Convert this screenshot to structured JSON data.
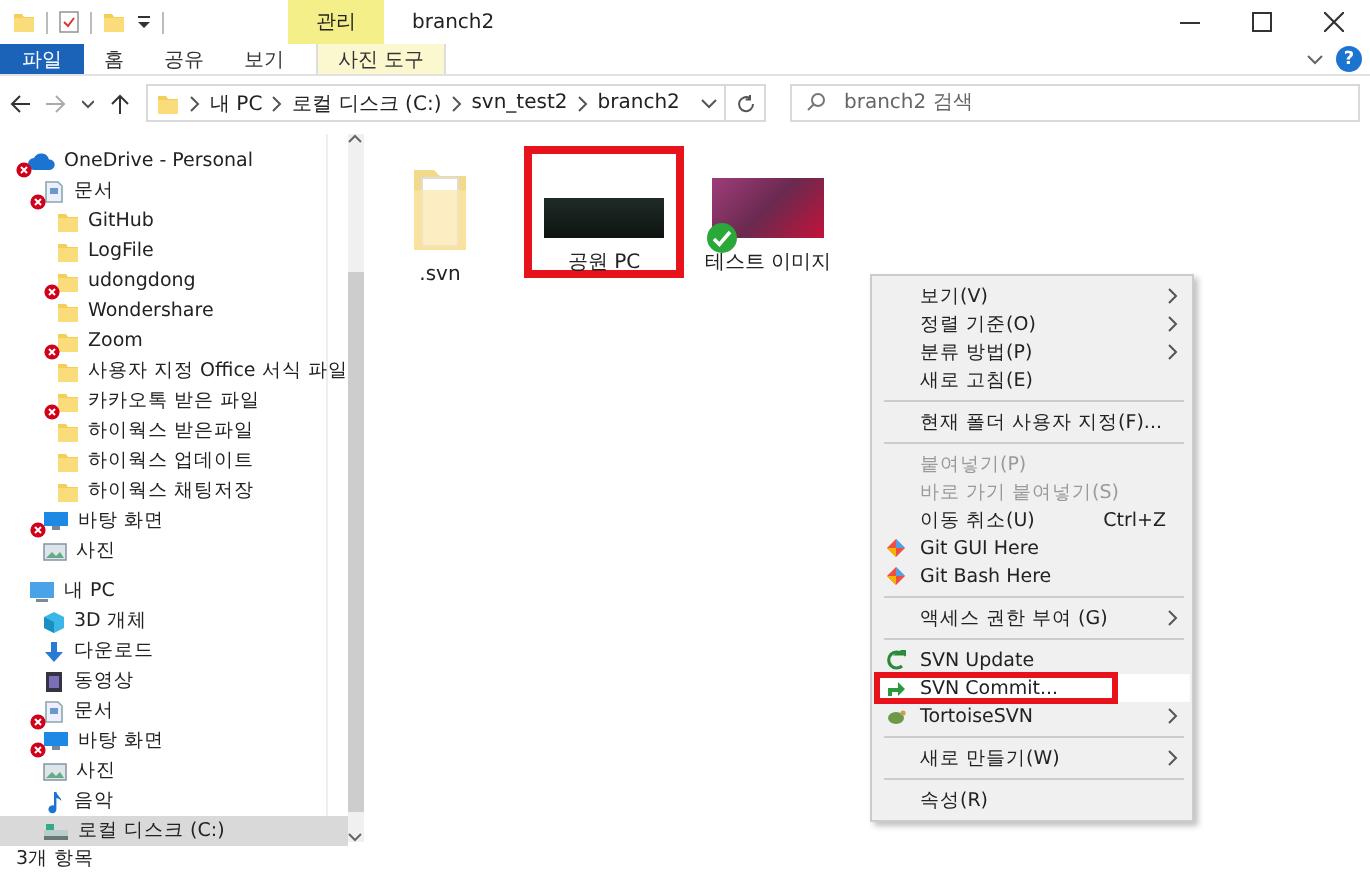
{
  "window": {
    "title": "branch2",
    "context_tab": "관리"
  },
  "ribbon": {
    "tabs": [
      {
        "label": "파일",
        "kind": "file",
        "selected": false
      },
      {
        "label": "홈",
        "kind": "tab",
        "selected": false
      },
      {
        "label": "공유",
        "kind": "tab",
        "selected": false
      },
      {
        "label": "보기",
        "kind": "tab",
        "selected": false
      },
      {
        "label": "사진 도구",
        "kind": "context",
        "selected": false
      }
    ],
    "help": "?"
  },
  "address": {
    "path": [
      "내 PC",
      "로컬 디스크 (C:)",
      "svn_test2",
      "branch2"
    ],
    "search_placeholder": "branch2 검색"
  },
  "navigation": [
    {
      "label": "OneDrive - Personal",
      "sync_error": true,
      "selected": false,
      "children": [
        {
          "label": "문서",
          "sync_error": true,
          "selected": false,
          "children": [
            {
              "label": "GitHub",
              "sync_error": false,
              "selected": false
            },
            {
              "label": "LogFile",
              "sync_error": false,
              "selected": false
            },
            {
              "label": "udongdong",
              "sync_error": true,
              "selected": false
            },
            {
              "label": "Wondershare",
              "sync_error": false,
              "selected": false
            },
            {
              "label": "Zoom",
              "sync_error": true,
              "selected": false
            },
            {
              "label": "사용자 지정 Office 서식 파일",
              "sync_error": false,
              "selected": false
            },
            {
              "label": "카카오톡 받은 파일",
              "sync_error": true,
              "selected": false
            },
            {
              "label": "하이웍스 받은파일",
              "sync_error": false,
              "selected": false
            },
            {
              "label": "하이웍스 업데이트",
              "sync_error": false,
              "selected": false
            },
            {
              "label": "하이웍스 채팅저장",
              "sync_error": false,
              "selected": false
            }
          ]
        },
        {
          "label": "바탕 화면",
          "sync_error": true,
          "selected": false
        },
        {
          "label": "사진",
          "sync_error": false,
          "selected": false
        }
      ]
    },
    {
      "label": "내 PC",
      "sync_error": false,
      "selected": false,
      "children": [
        {
          "label": "3D 개체",
          "sync_error": false,
          "selected": false
        },
        {
          "label": "다운로드",
          "sync_error": false,
          "selected": false
        },
        {
          "label": "동영상",
          "sync_error": false,
          "selected": false
        },
        {
          "label": "문서",
          "sync_error": true,
          "selected": false
        },
        {
          "label": "바탕 화면",
          "sync_error": true,
          "selected": false
        },
        {
          "label": "사진",
          "sync_error": false,
          "selected": false
        },
        {
          "label": "음악",
          "sync_error": false,
          "selected": false
        },
        {
          "label": "로컬 디스크 (C:)",
          "sync_error": false,
          "selected": true
        }
      ]
    }
  ],
  "files": [
    {
      "name": ".svn",
      "kind": "folder",
      "synced": false,
      "highlighted": false
    },
    {
      "name": "공원 PC",
      "kind": "dark-photo",
      "synced": false,
      "highlighted": true
    },
    {
      "name": "테스트 이미지",
      "kind": "red-photo",
      "synced": true,
      "highlighted": false
    }
  ],
  "context_menu": [
    {
      "kind": "item",
      "label": "보기(V)",
      "submenu": true,
      "disabled": false,
      "hovered": false,
      "highlighted": false
    },
    {
      "kind": "item",
      "label": "정렬 기준(O)",
      "submenu": true,
      "disabled": false,
      "hovered": false,
      "highlighted": false
    },
    {
      "kind": "item",
      "label": "분류 방법(P)",
      "submenu": true,
      "disabled": false,
      "hovered": false,
      "highlighted": false
    },
    {
      "kind": "item",
      "label": "새로 고침(E)",
      "submenu": false,
      "disabled": false,
      "hovered": false,
      "highlighted": false
    },
    {
      "kind": "separator"
    },
    {
      "kind": "item",
      "label": "현재 폴더 사용자 지정(F)...",
      "submenu": false,
      "disabled": false,
      "hovered": false,
      "highlighted": false
    },
    {
      "kind": "separator"
    },
    {
      "kind": "item",
      "label": "붙여넣기(P)",
      "submenu": false,
      "disabled": true,
      "hovered": false,
      "highlighted": false
    },
    {
      "kind": "item",
      "label": "바로 가기 붙여넣기(S)",
      "submenu": false,
      "disabled": true,
      "hovered": false,
      "highlighted": false
    },
    {
      "kind": "item",
      "label": "이동 취소(U)",
      "shortcut": "Ctrl+Z",
      "submenu": false,
      "disabled": false,
      "hovered": false,
      "highlighted": false
    },
    {
      "kind": "item",
      "label": "Git GUI Here",
      "submenu": false,
      "disabled": false,
      "hovered": false,
      "highlighted": false
    },
    {
      "kind": "item",
      "label": "Git Bash Here",
      "submenu": false,
      "disabled": false,
      "hovered": false,
      "highlighted": false
    },
    {
      "kind": "separator"
    },
    {
      "kind": "item",
      "label": "액세스 권한 부여 (G)",
      "submenu": true,
      "disabled": false,
      "hovered": false,
      "highlighted": false
    },
    {
      "kind": "separator"
    },
    {
      "kind": "item",
      "label": "SVN Update",
      "submenu": false,
      "disabled": false,
      "hovered": false,
      "highlighted": false
    },
    {
      "kind": "item",
      "label": "SVN Commit...",
      "submenu": false,
      "disabled": false,
      "hovered": true,
      "highlighted": true
    },
    {
      "kind": "item",
      "label": "TortoiseSVN",
      "submenu": true,
      "disabled": false,
      "hovered": false,
      "highlighted": false
    },
    {
      "kind": "separator"
    },
    {
      "kind": "item",
      "label": "새로 만들기(W)",
      "submenu": true,
      "disabled": false,
      "hovered": false,
      "highlighted": false
    },
    {
      "kind": "separator"
    },
    {
      "kind": "item",
      "label": "속성(R)",
      "submenu": false,
      "disabled": false,
      "hovered": false,
      "highlighted": false
    }
  ],
  "status_bar": {
    "count": "3개 항목"
  }
}
